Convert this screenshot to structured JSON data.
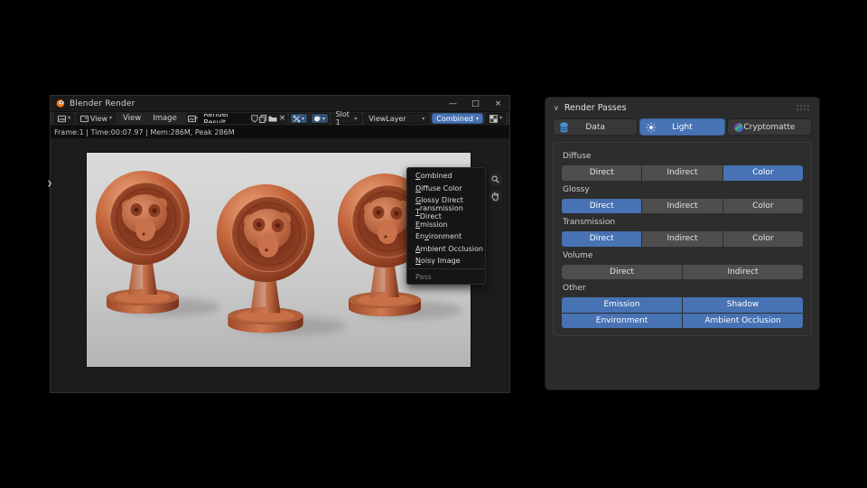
{
  "icons": {
    "chevron_down": "▾",
    "minimize": "—",
    "maximize": "□",
    "close": "×",
    "panel_chevron": "∨",
    "region_arrow": "❯"
  },
  "blender_window": {
    "title": "Blender Render",
    "header": {
      "display_mode": "View",
      "menu_view": "View",
      "menu_image": "Image",
      "image_name": "Render Result",
      "slot": "Slot 1",
      "view_layer": "ViewLayer",
      "pass": "Combined"
    },
    "status_bar": "Frame:1  |  Time:00:07.97  |  Mem:286M, Peak 286M",
    "pass_menu": {
      "items": [
        {
          "label": "Combined",
          "accel": 0
        },
        {
          "label": "Diffuse Color",
          "accel": 0
        },
        {
          "label": "Glossy Direct",
          "accel": 0
        },
        {
          "label": "Transmission Direct",
          "accel": 0
        },
        {
          "label": "Emission",
          "accel": 0
        },
        {
          "label": "Environment",
          "accel": 2
        },
        {
          "label": "Ambient Occlusion",
          "accel": 0
        },
        {
          "label": "Noisy Image",
          "accel": 0
        }
      ],
      "footer": "Pass"
    }
  },
  "render_passes_panel": {
    "title": "Render Passes",
    "accent_color": "#4772b3",
    "tabs": [
      {
        "label": "Data",
        "icon": "database-icon",
        "selected": false
      },
      {
        "label": "Light",
        "icon": "light-icon",
        "selected": true
      },
      {
        "label": "Cryptomatte",
        "icon": "cryptomatte-icon",
        "selected": false
      }
    ],
    "sections": [
      {
        "label": "Diffuse",
        "buttons": [
          {
            "label": "Direct",
            "selected": false
          },
          {
            "label": "Indirect",
            "selected": false
          },
          {
            "label": "Color",
            "selected": true
          }
        ]
      },
      {
        "label": "Glossy",
        "buttons": [
          {
            "label": "Direct",
            "selected": true
          },
          {
            "label": "Indirect",
            "selected": false
          },
          {
            "label": "Color",
            "selected": false
          }
        ]
      },
      {
        "label": "Transmission",
        "buttons": [
          {
            "label": "Direct",
            "selected": true
          },
          {
            "label": "Indirect",
            "selected": false
          },
          {
            "label": "Color",
            "selected": false
          }
        ]
      },
      {
        "label": "Volume",
        "buttons": [
          {
            "label": "Direct",
            "selected": false
          },
          {
            "label": "Indirect",
            "selected": false
          }
        ]
      },
      {
        "label": "Other",
        "buttons": [
          {
            "label": "Emission",
            "selected": true
          },
          {
            "label": "Shadow",
            "selected": true
          },
          {
            "label": "Environment",
            "selected": true
          },
          {
            "label": "Ambient Occlusion",
            "selected": true
          }
        ]
      }
    ]
  }
}
